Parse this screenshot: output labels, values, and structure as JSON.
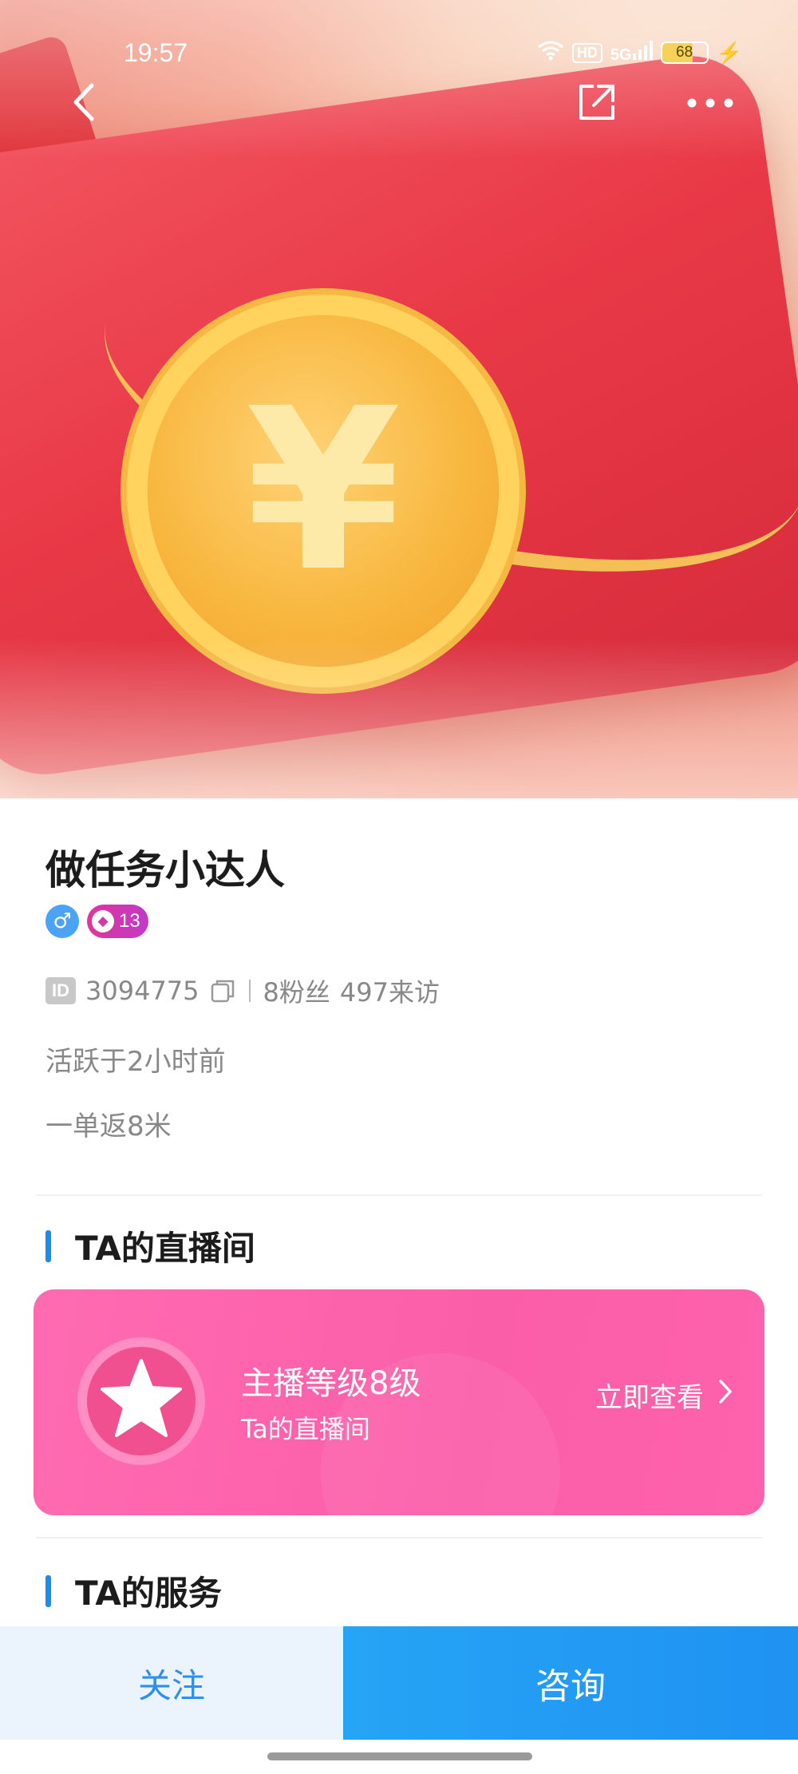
{
  "status_bar": {
    "time": "19:57",
    "hd": "HD",
    "network": "5G",
    "battery": "68",
    "icons": [
      "wifi-icon",
      "signal-icon",
      "battery-icon",
      "charging-icon"
    ]
  },
  "nav": {
    "icons": [
      "back-arrow-icon",
      "share-icon",
      "more-icon"
    ]
  },
  "hero": {
    "symbol": "¥"
  },
  "profile": {
    "name": "做任务小达人",
    "gender_symbol": "♂",
    "level": "13",
    "id_tag": "ID",
    "id": "3094775",
    "fans": "8粉丝",
    "visits": "497来访",
    "active": "活跃于2小时前",
    "description": "一单返8米"
  },
  "live_section": {
    "title": "TA的直播间",
    "card_title": "主播等级8级",
    "card_subtitle": "Ta的直播间",
    "action": "立即查看",
    "accent": "#fb5ea9"
  },
  "service_section": {
    "title": "TA的服务"
  },
  "bottom_bar": {
    "follow": "关注",
    "consult": "咨询",
    "primary_color": "#1f92f2"
  }
}
